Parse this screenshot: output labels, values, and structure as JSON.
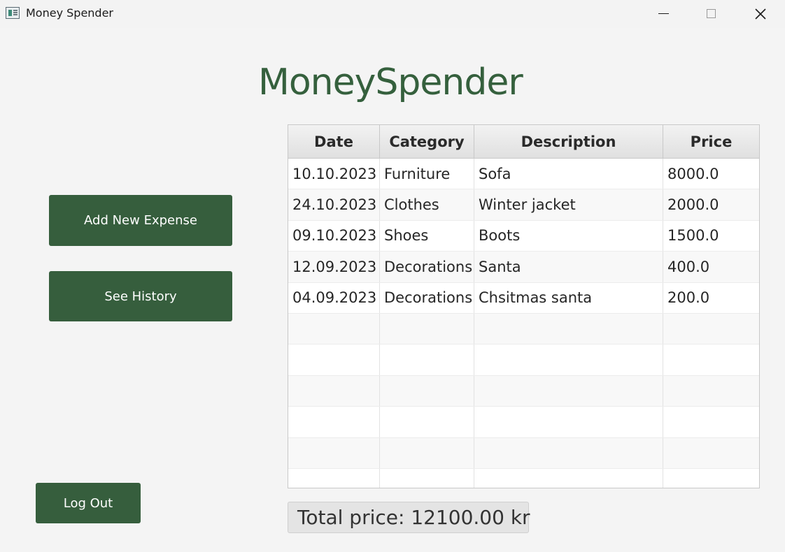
{
  "window": {
    "title": "Money Spender"
  },
  "header": {
    "title": "MoneySpender"
  },
  "actions": {
    "add_expense_label": "Add New Expense",
    "see_history_label": "See History",
    "logout_label": "Log Out"
  },
  "table": {
    "columns": [
      "Date",
      "Category",
      "Description",
      "Price"
    ],
    "rows": [
      [
        "10.10.2023",
        "Furniture",
        "Sofa",
        "8000.0"
      ],
      [
        "24.10.2023",
        "Clothes",
        "Winter jacket",
        "2000.0"
      ],
      [
        "09.10.2023",
        "Shoes",
        "Boots",
        "1500.0"
      ],
      [
        "12.09.2023",
        "Decorations",
        "Santa",
        "400.0"
      ],
      [
        "04.09.2023",
        "Decorations",
        "Chsitmas santa",
        "200.0"
      ],
      [
        "",
        "",
        "",
        ""
      ],
      [
        "",
        "",
        "",
        ""
      ],
      [
        "",
        "",
        "",
        ""
      ],
      [
        "",
        "",
        "",
        ""
      ],
      [
        "",
        "",
        "",
        ""
      ],
      [
        "",
        "",
        "",
        ""
      ]
    ]
  },
  "summary": {
    "total_text": "Total price: 12100.00 kr"
  },
  "colors": {
    "accent": "#365e3d",
    "heading": "#35603d",
    "background": "#f4f4f4"
  },
  "icons": [
    "app-icon",
    "minimize-icon",
    "maximize-icon",
    "close-icon"
  ]
}
